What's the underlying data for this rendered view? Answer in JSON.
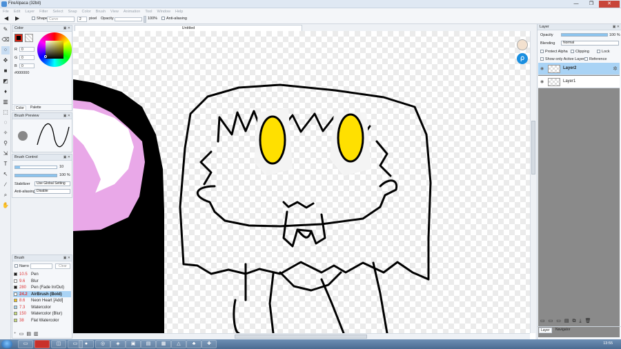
{
  "window": {
    "title": "FireAlpaca (32bit)",
    "controls": [
      "—",
      "❐",
      "✕"
    ]
  },
  "menu": [
    "File",
    "Edit",
    "Layer",
    "Filter",
    "Select",
    "Snap",
    "Color",
    "Brush",
    "View",
    "Animation",
    "Tool",
    "Window",
    "Help"
  ],
  "tool_options": {
    "shape_label": "Shape",
    "shape_value": "Curve",
    "size_value": "2",
    "size_unit": "pixel",
    "opacity_label": "Opacity",
    "opacity_value": "100%",
    "antialias_label": "Anti-aliasing"
  },
  "document_tab": "Untitled",
  "color_panel": {
    "title": "Color",
    "r_label": "R",
    "r_value": "0",
    "g_label": "G",
    "g_value": "0",
    "b_label": "B",
    "b_value": "0",
    "hex": "#000000",
    "tab_color": "Color",
    "tab_palette": "Palette",
    "fg_color": "#000000"
  },
  "brush_preview": {
    "title": "Brush Preview"
  },
  "brush_control": {
    "title": "Brush Control",
    "size_value": "10",
    "opacity_value": "100 %",
    "stabilizer_label": "Stabilizer",
    "stabilizer_value": "Use Global Setting",
    "antialias_label": "Anti-aliasing",
    "antialias_value": "Disable"
  },
  "brush_panel": {
    "title": "Brush",
    "narrow_label": "Narro",
    "clear_label": "Clear",
    "items": [
      {
        "size": "10.5",
        "name": "Pen",
        "color": "#1a1a1a",
        "selected": false
      },
      {
        "size": "9.6",
        "name": "Blur",
        "color": "#ffffff",
        "selected": false
      },
      {
        "size": "280",
        "name": "Pen (Fade In/Out)",
        "color": "#1a1a1a",
        "selected": false
      },
      {
        "size": "24.2",
        "name": "AirBrush (Bold)",
        "color": "#ffffff",
        "selected": true
      },
      {
        "size": "8.6",
        "name": "Neon Heart [Add]",
        "color": "#f2c81a",
        "selected": false
      },
      {
        "size": "7.3",
        "name": "Watercolor",
        "color": "#a8d8f0",
        "selected": false
      },
      {
        "size": "150",
        "name": "Watercolor (Blur)",
        "color": "#c9e07a",
        "selected": false
      },
      {
        "size": "38",
        "name": "Flat Watercolor",
        "color": "#c9e07a",
        "selected": false
      }
    ]
  },
  "layer_panel": {
    "title": "Layer",
    "opacity_label": "Opacity",
    "opacity_value": "100 %",
    "blending_label": "Blending",
    "blending_value": "Normal",
    "protect_alpha": "Protect Alpha",
    "clipping": "Clipping",
    "lock": "Lock",
    "show_active": "Show only Active Layer",
    "reference": "Reference",
    "layers": [
      {
        "name": "Layer2",
        "selected": true
      },
      {
        "name": "Layer1",
        "selected": false
      }
    ],
    "tab_layer": "Layer",
    "tab_navigator": "Navigator"
  },
  "taskbar": {
    "clock": "13:55"
  }
}
